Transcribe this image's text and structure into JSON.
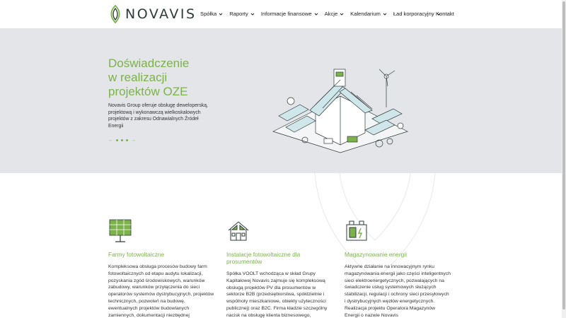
{
  "brand": {
    "name": "NOVAVIS",
    "accent": "#7bb24a",
    "dark": "#2f3b3a"
  },
  "nav": {
    "items": [
      {
        "label": "Spółka",
        "icon": "chevron-down-icon"
      },
      {
        "label": "Raporty",
        "icon": "chevron-down-icon"
      },
      {
        "label": "Informacje finansowe",
        "icon": "chevron-down-icon"
      },
      {
        "label": "Akcje",
        "icon": "chevron-down-icon"
      },
      {
        "label": "Kalendarium",
        "icon": "chevron-down-icon"
      },
      {
        "label": "Ład korporacyjny",
        "icon": "chevron-down-icon"
      }
    ],
    "contact_label": "Kontakt"
  },
  "hero": {
    "title_lines": [
      "Doświadczenie",
      "w realizacji",
      "projektów OZE"
    ],
    "description": "Novavis Group oferuje obsługę deweloperską, projektową i wykonawczą wielkoskalowych projektów z zakresu Odnawialnych Źródeł Energii",
    "prev_arrow": "←",
    "next_arrow": "→",
    "illustration": "solar-house-illustration",
    "background": "#e4e5e9"
  },
  "features": [
    {
      "icon": "solar-panel-icon",
      "title": "Farmy fotowoltaiczne",
      "text": "Kompleksowa obsługa procesów budowy farm fotowoltaicznych od etapu audytu lokalizacji, pozyskania zgód środowiskowych, warunków zabudowy, warunków przyłączenia do sieci operatorów systemów dystrybucyjnych, projektów technicznych, pozwoleń na budowę, ewentualnych projektów budowlanych zamiennych, dokumentacji niezbędnej"
    },
    {
      "icon": "house-solar-icon",
      "title": "Instalacje fotowoltaiczne dla prosumentów",
      "text": "Spółka VOOLT wchodząca w skład Grupy Kapitałowej Novavis zajmuje się kompleksową obsługą projektów PV dla prosumentów w sektorze B2B (przedsiębiorstwa, spółdzielnie i wspólnoty mieszkaniowe, obiekty użyteczności publicznej) oraz B2C. Firma kładzie szczególny nacisk na obsługę klienta biznesowego,"
    },
    {
      "icon": "energy-storage-icon",
      "title": "Magazynowanie energii",
      "text": "Aktywne działanie na innowacyjnym rynku magazynowania energii jako części inteligentnych sieci elektroenergetycznych, pozwalających na świadczenie usług systemowych służących stabilizacji, regulacji i ochrony sieci przesyłowych i dystrybucyjnych węzłów energetycznych. Realizacja projektu Operatora Magazynów Energii o nazwie Novavis"
    }
  ]
}
